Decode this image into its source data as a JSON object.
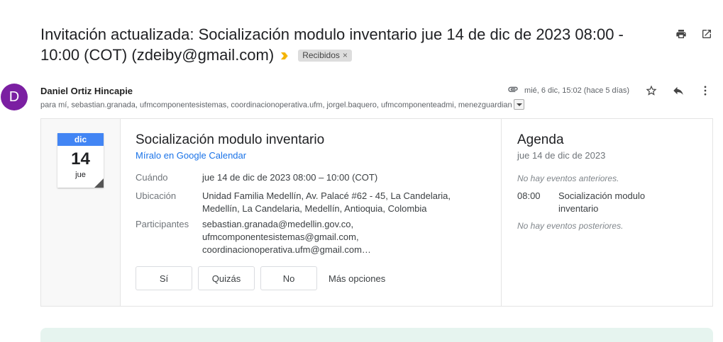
{
  "email": {
    "subject": "Invitación actualizada: Socialización modulo inventario jue 14 de dic de 2023 08:00 - 10:00 (COT) (zdeiby@gmail.com)",
    "label": "Recibidos",
    "label_close": "×",
    "sender_initial": "D",
    "sender_name": "Daniel Ortiz Hincapie",
    "recipients": "para mí, sebastian.granada, ufmcomponentesistemas, coordinacionoperativa.ufm, jorgel.baquero, ufmcomponenteadmi, menezguardian",
    "date": "mié, 6 dic, 15:02 (hace 5 días)",
    "icons": [
      "print-icon",
      "open-new-window-icon",
      "attachment-icon",
      "star-icon",
      "reply-icon",
      "more-vert-icon",
      "importance-marker-icon"
    ]
  },
  "calendar_icon": {
    "month": "dic",
    "day": "14",
    "weekday": "jue"
  },
  "event": {
    "title": "Socialización modulo inventario",
    "calendar_link": "Míralo en Google Calendar",
    "when_label": "Cuándo",
    "when": "jue 14 de dic de 2023 08:00 – 10:00 (COT)",
    "location_label": "Ubicación",
    "location_line1": "Unidad Familia Medellín, Av. Palacé #62 - 45, La Candelaria,",
    "location_line2": "Medellín, La Candelaria, Medellín, Antioquia, Colombia",
    "participants_label": "Participantes",
    "participants": [
      "sebastian.granada@medellin.gov.co,",
      "ufmcomponentesistemas@gmail.com,",
      "coordinacionoperativa.ufm@gmail.com…"
    ]
  },
  "rsvp": {
    "yes": "Sí",
    "maybe": "Quizás",
    "no": "No",
    "more": "Más opciones"
  },
  "agenda": {
    "title": "Agenda",
    "date": "jue 14 de dic de 2023",
    "before": "No hay eventos anteriores.",
    "event_time": "08:00",
    "event_name": "Socialización modulo inventario",
    "after": "No hay eventos posteriores."
  },
  "colors": {
    "avatar": "#7b1fa2",
    "calendar_month": "#4285f4",
    "link": "#1a73e8",
    "importance": "#f4b400"
  }
}
